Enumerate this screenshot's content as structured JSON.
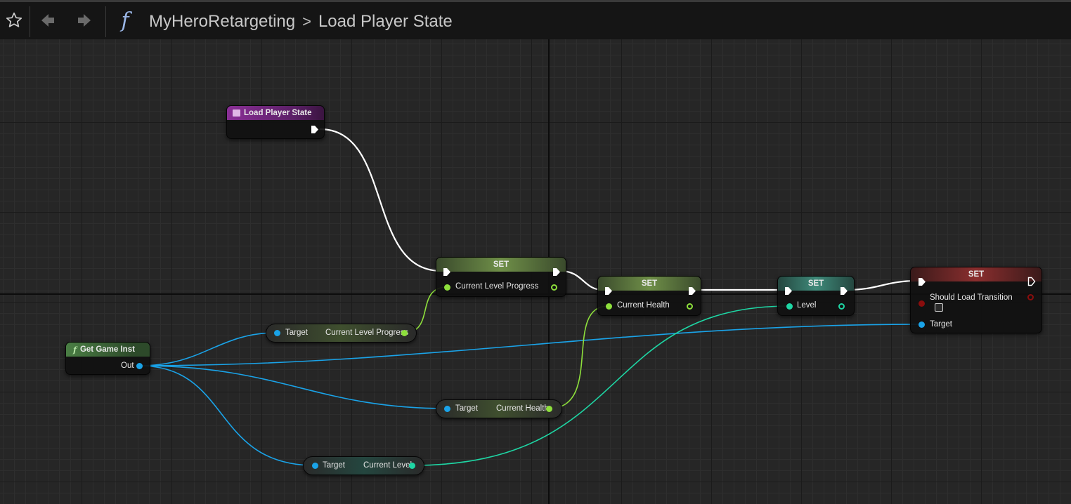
{
  "toolbar": {
    "icons": [
      "star-icon",
      "back-arrow-icon",
      "forward-arrow-icon",
      "function-icon"
    ],
    "function_glyph": "f"
  },
  "breadcrumb": {
    "blueprint": "MyHeroRetargeting",
    "separator": ">",
    "function": "Load Player State"
  },
  "nodes": {
    "entry": {
      "title": "Load Player State",
      "color": "#7a2a86"
    },
    "get_game_inst": {
      "title": "Get Game Inst",
      "glyph": "f",
      "out": "Out",
      "color": "#3d6b3a"
    },
    "set1": {
      "title": "SET",
      "pin": "Current Level Progress",
      "color": "#5d7a3a"
    },
    "set2": {
      "title": "SET",
      "pin": "Current Health",
      "color": "#5d7a3a"
    },
    "set3": {
      "title": "SET",
      "pin": "Level",
      "color": "#2f7a6e"
    },
    "set4": {
      "title": "SET",
      "pin": "Should Load Transition",
      "target": "Target",
      "color": "#8a2a2a"
    },
    "get_progress": {
      "target": "Target",
      "value": "Current Level Progress"
    },
    "get_health": {
      "target": "Target",
      "value": "Current Health"
    },
    "get_level": {
      "target": "Target",
      "value": "Current Level"
    }
  },
  "colors": {
    "exec": "#ffffff",
    "object_pin": "#1aa3e8",
    "float_pin": "#8ee03c",
    "int_pin": "#1ed6a4",
    "bool_pin": "#8a0d0d"
  }
}
